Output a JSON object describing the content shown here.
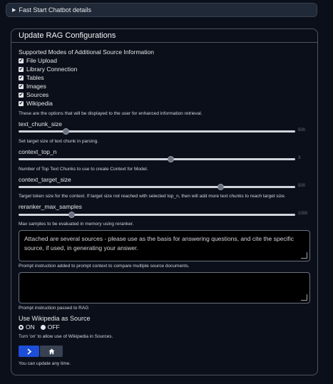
{
  "details": {
    "label": "Fast Start Chatbot details"
  },
  "panel": {
    "title": "Update RAG Configurations",
    "modes_label": "Supported Modes of Additional Source Information",
    "modes": [
      {
        "label": "File Upload",
        "checked": true
      },
      {
        "label": "Library Connection",
        "checked": true
      },
      {
        "label": "Tables",
        "checked": true
      },
      {
        "label": "Images",
        "checked": true
      },
      {
        "label": "Sources",
        "checked": true
      },
      {
        "label": "Wikipedia",
        "checked": true
      }
    ],
    "modes_info": "These are the options that will be displayed to the user for enhanced information retrieval.",
    "sliders": [
      {
        "label": "text_chunk_size",
        "max": "500",
        "fraction": 0.17,
        "info": "Set target size of text chunk in parsing."
      },
      {
        "label": "context_top_n",
        "max": "3",
        "fraction": 0.55,
        "info": "Number of Top Text Chunks to use to create Context for Model."
      },
      {
        "label": "context_target_size",
        "max": "500",
        "fraction": 0.73,
        "info": "Target token size for the context. If target size not reached with selected top_n, then will add more text chunks to reach target size."
      },
      {
        "label": "reranker_max_samples",
        "max": "1000",
        "fraction": 0.19,
        "info": "Max samples to be evaluated in memory using reranker."
      }
    ],
    "prompt_text": "Attached are several sources - please use as the basis for answering questions, and cite the specific source, if used, in generating your answer.",
    "prompt_info": "Prompt instruction added to prompt context to compare multiple source documents.",
    "rag_prompt_text": "",
    "rag_prompt_info": "Prompt instruction passed to RAG",
    "wiki_label": "Use Wikipedia as Source",
    "wiki_on": "ON",
    "wiki_off": "OFF",
    "wiki_selected": "ON",
    "wiki_info": "Turn 'on' to allow use of Wikipedia in Sources.",
    "submit_icon": "chevron-right-icon",
    "home_icon": "home-icon",
    "footer": "You can update any time."
  },
  "colors": {
    "submit_bg": "#1d4ed8",
    "home_bg": "#374151",
    "bg": "#0b0f19"
  }
}
